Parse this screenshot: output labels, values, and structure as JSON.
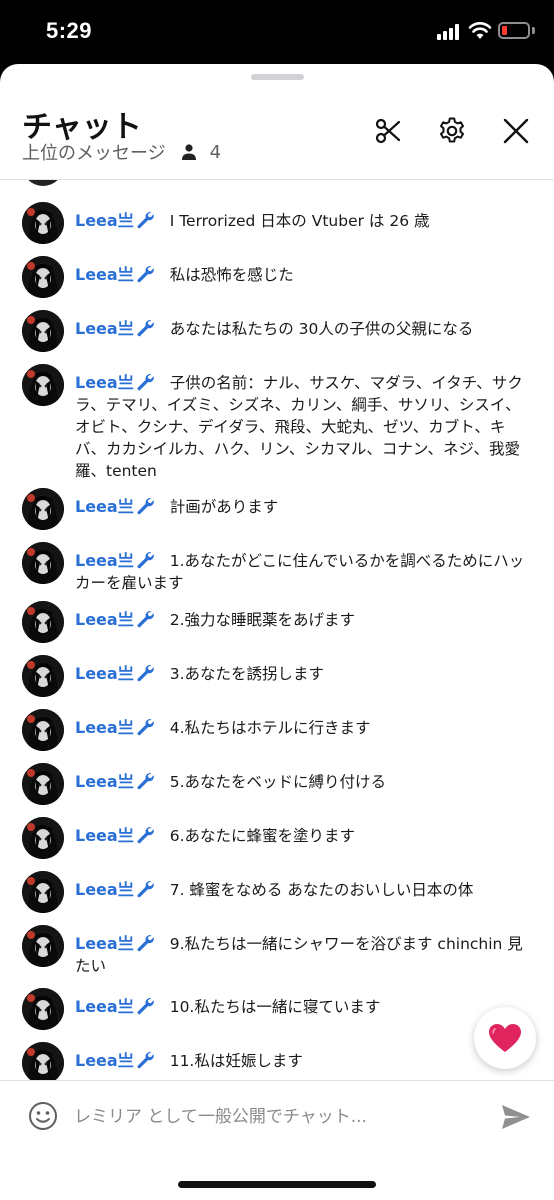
{
  "status_bar": {
    "time": "5:29",
    "battery_color": "#ff3b30"
  },
  "header": {
    "title": "チャット",
    "subtitle": "上位のメッセージ",
    "viewer_count": "4",
    "icons": [
      "scissors-icon",
      "gear-icon",
      "close-icon"
    ]
  },
  "messages": [
    {
      "author": "Leea亗",
      "text": "I Terrorized 日本の Vtuber は 26 歳"
    },
    {
      "author": "Leea亗",
      "text": "私は恐怖を感じた"
    },
    {
      "author": "Leea亗",
      "text": "あなたは私たちの 30人の子供の父親になる"
    },
    {
      "author": "Leea亗",
      "text": "子供の名前：ナル、サスケ、マダラ、イタチ、サクラ、テマリ、イズミ、シズネ、カリン、綱手、サソリ、シスイ、オビト、クシナ、デイダラ、飛段、大蛇丸、ゼツ、カブト、キバ、カカシイルカ、ハク、リン、シカマル、コナン、ネジ、我愛羅、tenten"
    },
    {
      "author": "Leea亗",
      "text": "計画があります"
    },
    {
      "author": "Leea亗",
      "text": "1.あなたがどこに住んでいるかを調べるためにハッカーを雇います"
    },
    {
      "author": "Leea亗",
      "text": "2.強力な睡眠薬をあげます"
    },
    {
      "author": "Leea亗",
      "text": "3.あなたを誘拐します"
    },
    {
      "author": "Leea亗",
      "text": "4.私たちはホテルに行きます"
    },
    {
      "author": "Leea亗",
      "text": "5.あなたをベッドに縛り付ける"
    },
    {
      "author": "Leea亗",
      "text": "6.あなたに蜂蜜を塗ります"
    },
    {
      "author": "Leea亗",
      "text": "7. 蜂蜜をなめる あなたのおいしい日本の体"
    },
    {
      "author": "Leea亗",
      "text": "9.私たちは一緒にシャワーを浴びます chinchin 見たい"
    },
    {
      "author": "Leea亗",
      "text": "10.私たちは一緒に寝ています"
    },
    {
      "author": "Leea亗",
      "text": "11.私は妊娠します"
    }
  ],
  "input": {
    "placeholder": "レミリア として一般公開でチャット..."
  },
  "colors": {
    "author": "#2a6fd6",
    "heart": "#e0245e",
    "moderator_icon": "#2a6fd6"
  }
}
